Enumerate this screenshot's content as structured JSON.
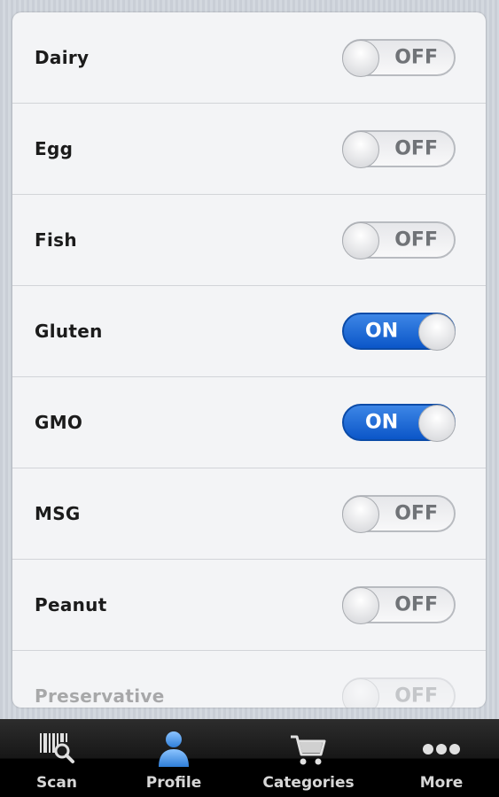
{
  "allergens": [
    {
      "label": "Dairy",
      "state": "OFF"
    },
    {
      "label": "Egg",
      "state": "OFF"
    },
    {
      "label": "Fish",
      "state": "OFF"
    },
    {
      "label": "Gluten",
      "state": "ON"
    },
    {
      "label": "GMO",
      "state": "ON"
    },
    {
      "label": "MSG",
      "state": "OFF"
    },
    {
      "label": "Peanut",
      "state": "OFF"
    },
    {
      "label": "Preservative",
      "state": "OFF"
    }
  ],
  "tabs": [
    {
      "label": "Scan",
      "icon": "barcode-scan-icon"
    },
    {
      "label": "Profile",
      "icon": "profile-person-icon"
    },
    {
      "label": "Categories",
      "icon": "shopping-cart-icon"
    },
    {
      "label": "More",
      "icon": "more-dots-icon"
    }
  ],
  "colors": {
    "toggle_on": "#1a63d6",
    "active_tab_icon": "#4f9ae8"
  }
}
